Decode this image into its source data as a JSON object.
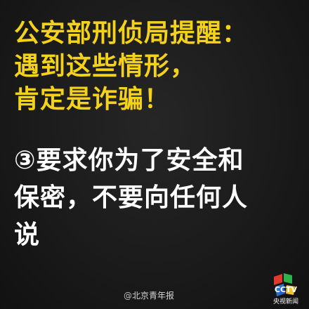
{
  "headline": {
    "line1": "公安部刑侦局提醒：",
    "line2": "遇到这些情形，",
    "line3": "肯定是诈骗！"
  },
  "body": {
    "line1": "③要求你为了安全和",
    "line2": "保密，不要向任何人",
    "line3": "说"
  },
  "watermark": {
    "at": "@",
    "text": "北京青年报"
  },
  "logo": {
    "brand": "CCTV",
    "caption": "央视新闻"
  },
  "colors": {
    "headline": "#f5d21a",
    "body": "#ffffff",
    "background": "#1b1b1b"
  }
}
